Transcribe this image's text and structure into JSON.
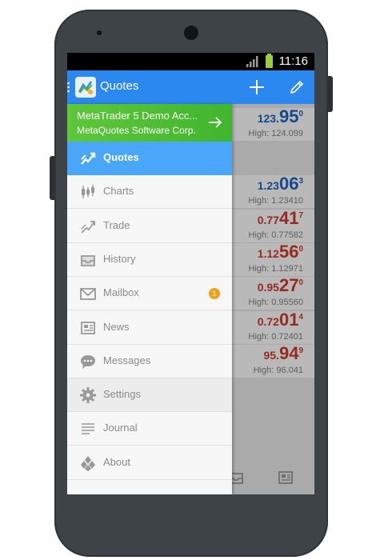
{
  "status": {
    "time": "11:16"
  },
  "appbar": {
    "title": "Quotes"
  },
  "account": {
    "name": "MetaTrader 5 Demo Acc...",
    "company": "MetaQuotes Software Corp."
  },
  "menu": [
    {
      "label": "Quotes",
      "icon": "quotes-icon",
      "active": true
    },
    {
      "label": "Charts",
      "icon": "charts-icon"
    },
    {
      "label": "Trade",
      "icon": "trade-icon"
    },
    {
      "label": "History",
      "icon": "history-icon"
    },
    {
      "label": "Mailbox",
      "icon": "mailbox-icon",
      "badge": "1"
    },
    {
      "label": "News",
      "icon": "news-icon"
    },
    {
      "label": "Messages",
      "icon": "messages-icon"
    },
    {
      "label": "Settings",
      "icon": "settings-icon"
    },
    {
      "label": "Journal",
      "icon": "journal-icon"
    },
    {
      "label": "About",
      "icon": "about-icon"
    }
  ],
  "quotes": [
    {
      "price_small": "123.",
      "price_big": "95",
      "price_sup": "0",
      "high": "High: 124.099",
      "color": "#1f5db4"
    },
    {
      "price_small": "1.23",
      "price_big": "06",
      "price_sup": "3",
      "high": "High: 1.23410",
      "color": "#1f5db4"
    },
    {
      "price_small": "0.77",
      "price_big": "41",
      "price_sup": "7",
      "high": "High: 0.77582",
      "color": "#c0392b"
    },
    {
      "price_small": "1.12",
      "price_big": "56",
      "price_sup": "0",
      "high": "High: 1.12971",
      "color": "#c0392b"
    },
    {
      "price_small": "0.95",
      "price_big": "27",
      "price_sup": "0",
      "high": "High: 0.95560",
      "color": "#c0392b"
    },
    {
      "price_small": "0.72",
      "price_big": "01",
      "price_sup": "4",
      "high": "High: 0.72401",
      "color": "#c0392b"
    },
    {
      "price_small": "95.",
      "price_big": "94",
      "price_sup": "9",
      "high": "High: 96.041",
      "color": "#c0392b"
    }
  ],
  "colors": {
    "appbar": "#2b88ee",
    "active_item": "#4aa6f8",
    "account": "#4cbc31",
    "badge": "#f4a11a"
  }
}
